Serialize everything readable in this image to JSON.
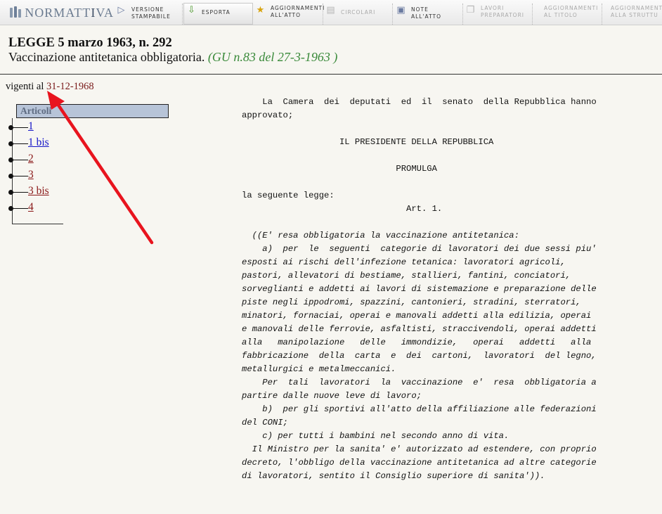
{
  "toolbar": {
    "logo_pre": "NORMATT",
    "logo_hi": "I",
    "logo_post": "VA",
    "buttons": [
      {
        "label": "Versione\nstampabile",
        "icon": "arrow-right-icon"
      },
      {
        "label": "Esporta",
        "icon": "download-icon"
      },
      {
        "label": "Aggiornamenti\nall'atto",
        "icon": "star-icon"
      },
      {
        "label": "Circolari",
        "icon": "document-icon"
      },
      {
        "label": "Note\nall'atto",
        "icon": "note-icon"
      },
      {
        "label": "Lavori\npreparatori",
        "icon": "pages-icon"
      },
      {
        "label": "Aggiornamenti\nal titolo"
      },
      {
        "label": "Aggiornamenti\nalla struttu"
      }
    ]
  },
  "header": {
    "title": "LEGGE 5 marzo 1963, n. 292",
    "subtitle": "Vaccinazione antitetanica obbligatoria.",
    "gazette": "(GU n.83 del 27-3-1963 )"
  },
  "vigenti": {
    "prefix": "vigenti al",
    "date": "31-12-1968"
  },
  "articles": {
    "heading": "Articoli",
    "items": [
      {
        "label": "1",
        "status": "current"
      },
      {
        "label": "1 bis",
        "status": "current"
      },
      {
        "label": "2",
        "status": "visited"
      },
      {
        "label": "3",
        "status": "visited"
      },
      {
        "label": "3 bis",
        "status": "visited"
      },
      {
        "label": "4",
        "status": "visited"
      }
    ]
  },
  "body": {
    "lines": [
      {
        "t": "    La  Camera  dei  deputati  ed  il  senato  della Repubblica hanno"
      },
      {
        "t": "approvato;"
      },
      {
        "t": ""
      },
      {
        "t": "                   IL PRESIDENTE DELLA REPUBBLICA"
      },
      {
        "t": ""
      },
      {
        "t": "                              PROMULGA"
      },
      {
        "t": ""
      },
      {
        "t": "la seguente legge:"
      },
      {
        "t": "                                Art. 1."
      },
      {
        "t": ""
      },
      {
        "t": "  ((E' resa obbligatoria la vaccinazione antitetanica:",
        "i": true
      },
      {
        "t": "    a)  per  le  seguenti  categorie di lavoratori dei due sessi piu'",
        "i": true
      },
      {
        "t": "esposti ai rischi dell'infezione tetanica: lavoratori agricoli,",
        "i": true
      },
      {
        "t": "pastori, allevatori di bestiame, stallieri, fantini, conciatori,",
        "i": true
      },
      {
        "t": "sorveglianti e addetti ai lavori di sistemazione e preparazione delle",
        "i": true
      },
      {
        "t": "piste negli ippodromi, spazzini, cantonieri, stradini, sterratori,",
        "i": true
      },
      {
        "t": "minatori, fornaciai, operai e manovali addetti alla edilizia, operai",
        "i": true
      },
      {
        "t": "e manovali delle ferrovie, asfaltisti, straccivendoli, operai addetti",
        "i": true
      },
      {
        "t": "alla   manipolazione   delle   immondizie,   operai   addetti   alla",
        "i": true
      },
      {
        "t": "fabbricazione  della  carta  e  dei  cartoni,  lavoratori  del legno,",
        "i": true
      },
      {
        "t": "metallurgici e metalmeccanici.",
        "i": true
      },
      {
        "t": "    Per  tali  lavoratori  la  vaccinazione  e'  resa  obbligatoria a",
        "i": true
      },
      {
        "t": "partire dalle nuove leve di lavoro;",
        "i": true
      },
      {
        "t": "    b)  per gli sportivi all'atto della affiliazione alle federazioni",
        "i": true
      },
      {
        "t": "del CONI;",
        "i": true
      },
      {
        "t": "    c) per tutti i bambini nel secondo anno di vita.",
        "i": true
      },
      {
        "t": "  Il Ministro per la sanita' e' autorizzato ad estendere, con proprio",
        "i": true
      },
      {
        "t": "decreto, l'obbligo della vaccinazione antitetanica ad altre categorie",
        "i": true
      },
      {
        "t": "di lavoratori, sentito il Consiglio superiore di sanita')).",
        "i": true
      }
    ]
  },
  "colors": {
    "arrow": "#e8141e",
    "link_current": "#1515c8",
    "link_visited": "#8a1818",
    "gazette": "#3a8a3a"
  }
}
